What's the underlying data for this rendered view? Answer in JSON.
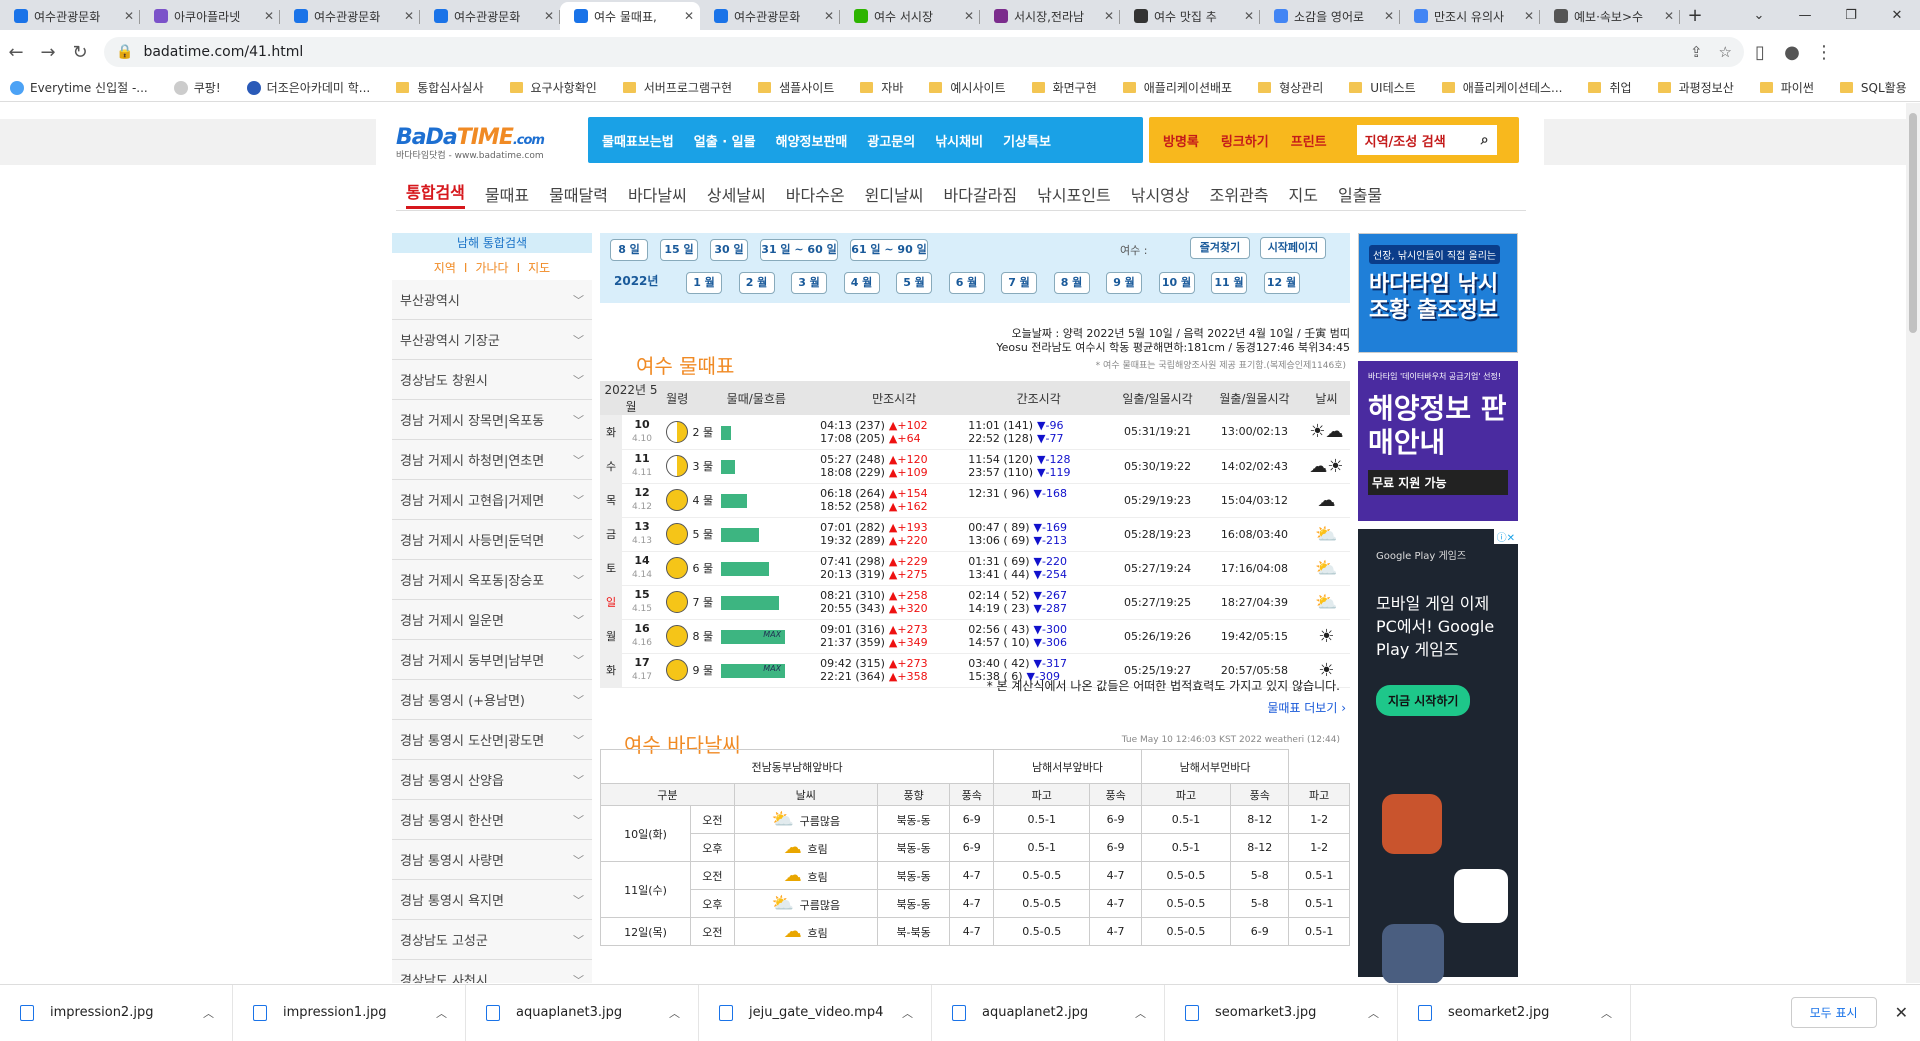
{
  "tabs": [
    {
      "label": "여수관광문화",
      "color": "#1a73e8"
    },
    {
      "label": "아쿠아플라넷",
      "color": "#7b52c9"
    },
    {
      "label": "여수관광문화",
      "color": "#1a73e8"
    },
    {
      "label": "여수관광문화",
      "color": "#1a73e8"
    },
    {
      "label": "여수 물때표,",
      "color": "#1a73e8",
      "active": true
    },
    {
      "label": "여수관광문화",
      "color": "#1a73e8"
    },
    {
      "label": "여수 서시장",
      "color": "#2db400"
    },
    {
      "label": "서시장,전라남",
      "color": "#7b2c8c"
    },
    {
      "label": "여수 맛집 추",
      "color": "#333333"
    },
    {
      "label": "소감을 영어로",
      "color": "#4285f4"
    },
    {
      "label": "만조시 유의사",
      "color": "#4285f4"
    },
    {
      "label": "예보·속보>수",
      "color": "#555555"
    }
  ],
  "url": "badatime.com/41.html",
  "bookmarks": [
    "Everytime 신입절 -...",
    "쿠팡!",
    "더조은아카데미 학...",
    "통합심사실사",
    "요구사항확인",
    "서버프로그램구현",
    "샘플사이트",
    "자바",
    "예시사이트",
    "화면구현",
    "애플리케이션배포",
    "형상관리",
    "UI테스트",
    "애플리케이션테스...",
    "취업",
    "과평정보산",
    "파이썬",
    "SQL활용"
  ],
  "logo": {
    "brand1": "BaDa",
    "brand2": "TIME",
    "dot": ".com",
    "sub": "바다타임닷컴 - www.badatime.com"
  },
  "topnav": [
    "물때표보는법",
    "얼출 · 일몰",
    "해양정보판매",
    "광고문의",
    "낚시채비",
    "기상특보"
  ],
  "topnav2": [
    "방명록",
    "링크하기",
    "프린트"
  ],
  "search_placeholder": "지역/조성 검색",
  "menu": [
    "통합검색",
    "물때표",
    "물때달력",
    "바다날씨",
    "상세날씨",
    "바다수온",
    "윈디날씨",
    "바다갈라짐",
    "낚시포인트",
    "낚시영상",
    "조위관측",
    "지도",
    "일출물"
  ],
  "sidebar": {
    "title": "남해 통합검색",
    "links": [
      "지역",
      "가나다",
      "지도"
    ],
    "items": [
      "부산광역시",
      "부산광역시 기장군",
      "경상남도 창원시",
      "경남 거제시 장목면|옥포동",
      "경남 거제시 하청면|연초면",
      "경남 거제시 고현읍|거제면",
      "경남 거제시 사등면|둔덕면",
      "경남 거제시 옥포동|장승포",
      "경남 거제시 일운면",
      "경남 거제시 동부면|남부면",
      "경남 통영시 (+용남면)",
      "경남 통영시 도산면|광도면",
      "경남 통영시 산양읍",
      "경남 통영시 한산면",
      "경남 통영시 사량면",
      "경남 통영시 욕지면",
      "경상남도 고성군",
      "경상남도 사천시"
    ]
  },
  "periods": [
    "8 일",
    "15 일",
    "30 일",
    "31 일 ~ 60 일",
    "61 일 ~ 90 일"
  ],
  "region_label": "여수 :",
  "fav_btn": "즐겨찾기",
  "start_btn": "시작페이지",
  "year": "2022년",
  "months": [
    "1 월",
    "2 월",
    "3 월",
    "4 월",
    "5 월",
    "6 월",
    "7 월",
    "8 월",
    "9 월",
    "10 월",
    "11 월",
    "12 월"
  ],
  "info_line1": "오늘날짜 : 양력 2022년 5월 10일 / 음력 2022년 4월 10일 / 壬寅 범띠",
  "info_line2": "Yeosu 전라남도 여수시 학동 평균해면하:181cm / 동경127:46 북위34:45",
  "info_source": "* 여수 물때표는 국립해양조사원 제공 표기함.(복제승인제1146호)",
  "tide_title": "여수 물때표",
  "tide_headers": [
    "2022년 5월",
    "월령",
    "물때/물흐름",
    "만조시각",
    "간조시각",
    "일출/일몰시각",
    "월출/월몰시각",
    "날씨"
  ],
  "tide_rows": [
    {
      "dow": "화",
      "day": "10",
      "lunar": "4.10",
      "mul": "2 물",
      "bar": 0.15,
      "h1": "04:13 (237)",
      "d1": "▲+102",
      "h2": "17:08 (205)",
      "d2": "▲+64",
      "l1": "11:01 (141)",
      "e1": "▼-96",
      "l2": "22:52 (128)",
      "e2": "▼-77",
      "sun": "05:31/19:21",
      "moon": "13:00/02:13",
      "wx": "☀☁"
    },
    {
      "dow": "수",
      "day": "11",
      "lunar": "4.11",
      "mul": "3 물",
      "bar": 0.22,
      "h1": "05:27 (248)",
      "d1": "▲+120",
      "h2": "18:08 (229)",
      "d2": "▲+109",
      "l1": "11:54 (120)",
      "e1": "▼-128",
      "l2": "23:57 (110)",
      "e2": "▼-119",
      "sun": "05:30/19:22",
      "moon": "14:02/02:43",
      "wx": "☁☀"
    },
    {
      "dow": "목",
      "day": "12",
      "lunar": "4.12",
      "mul": "4 물",
      "bar": 0.4,
      "h1": "06:18 (264)",
      "d1": "▲+154",
      "h2": "18:52 (258)",
      "d2": "▲+162",
      "l1": "12:31 ( 96)",
      "e1": "▼-168",
      "l2": "",
      "e2": "",
      "sun": "05:29/19:23",
      "moon": "15:04/03:12",
      "wx": "☁"
    },
    {
      "dow": "금",
      "day": "13",
      "lunar": "4.13",
      "mul": "5 물",
      "bar": 0.6,
      "h1": "07:01 (282)",
      "d1": "▲+193",
      "h2": "19:32 (289)",
      "d2": "▲+220",
      "l1": "00:47 ( 89)",
      "e1": "▼-169",
      "l2": "13:06 ( 69)",
      "e2": "▼-213",
      "sun": "05:28/19:23",
      "moon": "16:08/03:40",
      "wx": "⛅"
    },
    {
      "dow": "토",
      "day": "14",
      "lunar": "4.14",
      "mul": "6 물",
      "bar": 0.75,
      "h1": "07:41 (298)",
      "d1": "▲+229",
      "h2": "20:13 (319)",
      "d2": "▲+275",
      "l1": "01:31 ( 69)",
      "e1": "▼-220",
      "l2": "13:41 ( 44)",
      "e2": "▼-254",
      "sun": "05:27/19:24",
      "moon": "17:16/04:08",
      "wx": "⛅"
    },
    {
      "dow": "일",
      "day": "15",
      "lunar": "4.15",
      "mul": "7 물",
      "bar": 0.9,
      "h1": "08:21 (310)",
      "d1": "▲+258",
      "h2": "20:55 (343)",
      "d2": "▲+320",
      "l1": "02:14 ( 52)",
      "e1": "▼-267",
      "l2": "14:19 ( 23)",
      "e2": "▼-287",
      "sun": "05:27/19:25",
      "moon": "18:27/04:39",
      "wx": "⛅"
    },
    {
      "dow": "월",
      "day": "16",
      "lunar": "4.16",
      "mul": "8 물",
      "bar": 1.0,
      "max": "MAX",
      "h1": "09:01 (316)",
      "d1": "▲+273",
      "h2": "21:37 (359)",
      "d2": "▲+349",
      "l1": "02:56 ( 43)",
      "e1": "▼-300",
      "l2": "14:57 ( 10)",
      "e2": "▼-306",
      "sun": "05:26/19:26",
      "moon": "19:42/05:15",
      "wx": "☀"
    },
    {
      "dow": "화",
      "day": "17",
      "lunar": "4.17",
      "mul": "9 물",
      "bar": 1.0,
      "max": "MAX",
      "h1": "09:42 (315)",
      "d1": "▲+273",
      "h2": "22:21 (364)",
      "d2": "▲+358",
      "l1": "03:40 ( 42)",
      "e1": "▼-317",
      "l2": "15:38 (  6)",
      "e2": "▼-309",
      "sun": "05:25/19:27",
      "moon": "20:57/05:58",
      "wx": "☀"
    }
  ],
  "notice": "* 본 계산식에서 나온 값들은 어떠한 법적효력도 가지고 있지 않습니다.",
  "more_link": "물때표 더보기",
  "sea_title": "여수 바다날씨",
  "sea_time": "Tue May 10 12:46:03 KST 2022 weatheri (12:44)",
  "sea_regions": [
    "전남동부남해앞바다",
    "남해서부앞바다",
    "남해서부먼바다"
  ],
  "sea_cols": [
    "구분",
    "날씨",
    "풍향",
    "풍속",
    "파고",
    "풍속",
    "파고",
    "풍속",
    "파고"
  ],
  "sea_rows": [
    {
      "day": "10일(화)",
      "ampm": "오전",
      "wx": "구름많음",
      "dir": "북동-동",
      "s1": "6-9",
      "w1": "0.5-1",
      "s2": "6-9",
      "w2": "0.5-1",
      "s3": "8-12",
      "w3": "1-2"
    },
    {
      "day": "",
      "ampm": "오후",
      "wx": "흐림",
      "dir": "북동-동",
      "s1": "6-9",
      "w1": "0.5-1",
      "s2": "6-9",
      "w2": "0.5-1",
      "s3": "8-12",
      "w3": "1-2"
    },
    {
      "day": "11일(수)",
      "ampm": "오전",
      "wx": "흐림",
      "dir": "북동-동",
      "s1": "4-7",
      "w1": "0.5-0.5",
      "s2": "4-7",
      "w2": "0.5-0.5",
      "s3": "5-8",
      "w3": "0.5-1"
    },
    {
      "day": "",
      "ampm": "오후",
      "wx": "구름많음",
      "dir": "북동-동",
      "s1": "4-7",
      "w1": "0.5-0.5",
      "s2": "4-7",
      "w2": "0.5-0.5",
      "s3": "5-8",
      "w3": "0.5-1"
    },
    {
      "day": "12일(목)",
      "ampm": "오전",
      "wx": "흐림",
      "dir": "북-북동",
      "s1": "4-7",
      "w1": "0.5-0.5",
      "s2": "4-7",
      "w2": "0.5-0.5",
      "s3": "6-9",
      "w3": "0.5-1"
    }
  ],
  "ads": {
    "ad1_top": "선장, 낚시인들이 직접 올리는",
    "ad1_main": "바다타임 낚시조황 출조정보",
    "ad2_top": "바다타임 '데이터바우처 공급기업' 선정!",
    "ad2_main": "해양정보 판매안내",
    "ad2_bottom": "무료 지원 가능",
    "ad3_brand": "Google Play 게임즈",
    "ad3_text": "모바일 게임 이제 PC에서! Google Play 게임즈",
    "ad3_btn": "지금 시작하기"
  },
  "downloads": [
    "impression2.jpg",
    "impression1.jpg",
    "aquaplanet3.jpg",
    "jeju_gate_video.mp4",
    "aquaplanet2.jpg",
    "seomarket3.jpg",
    "seomarket2.jpg"
  ],
  "show_all": "모두 표시"
}
